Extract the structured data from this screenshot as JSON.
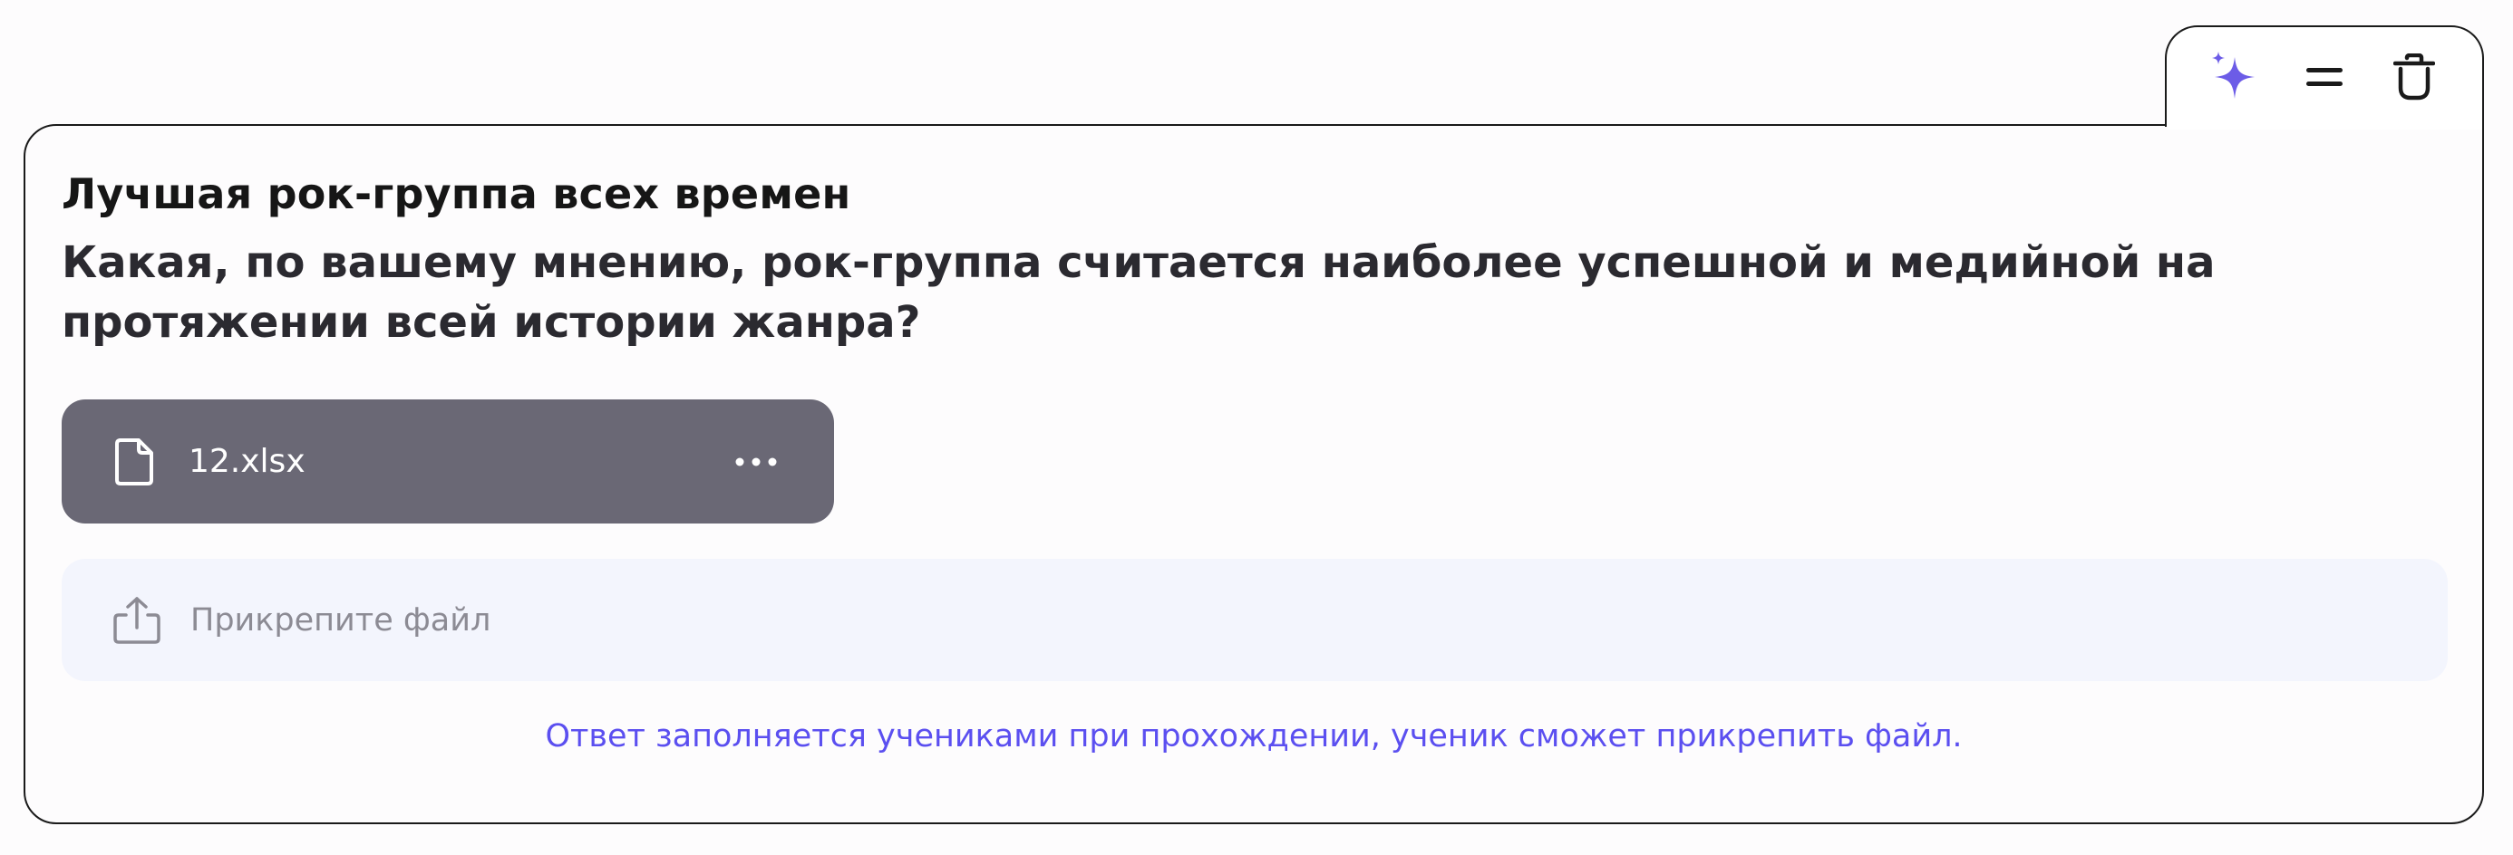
{
  "toolbar": {
    "ai_icon": "sparkles-icon",
    "drag_icon": "drag-handle-icon",
    "delete_icon": "trash-icon",
    "accent_color": "#6c5ce7"
  },
  "task": {
    "title": "Лучшая рок-группа всех времен",
    "question": "Какая, по вашему мнению, рок-группа считается наиболее успешной и медийной на протяжении всей истории жанра?"
  },
  "attachment": {
    "icon": "file-icon",
    "file_name": "12.xlsx",
    "menu_icon": "more-horizontal-icon"
  },
  "upload": {
    "icon": "upload-icon",
    "placeholder": "Прикрепите файл"
  },
  "hint": "Ответ заполняется учениками при прохождении, ученик сможет прикрепить файл.",
  "colors": {
    "chip_bg": "#6a6875",
    "upload_bg": "#f3f5fd",
    "hint_text": "#5b4ff0",
    "border": "#1a1a1a"
  }
}
